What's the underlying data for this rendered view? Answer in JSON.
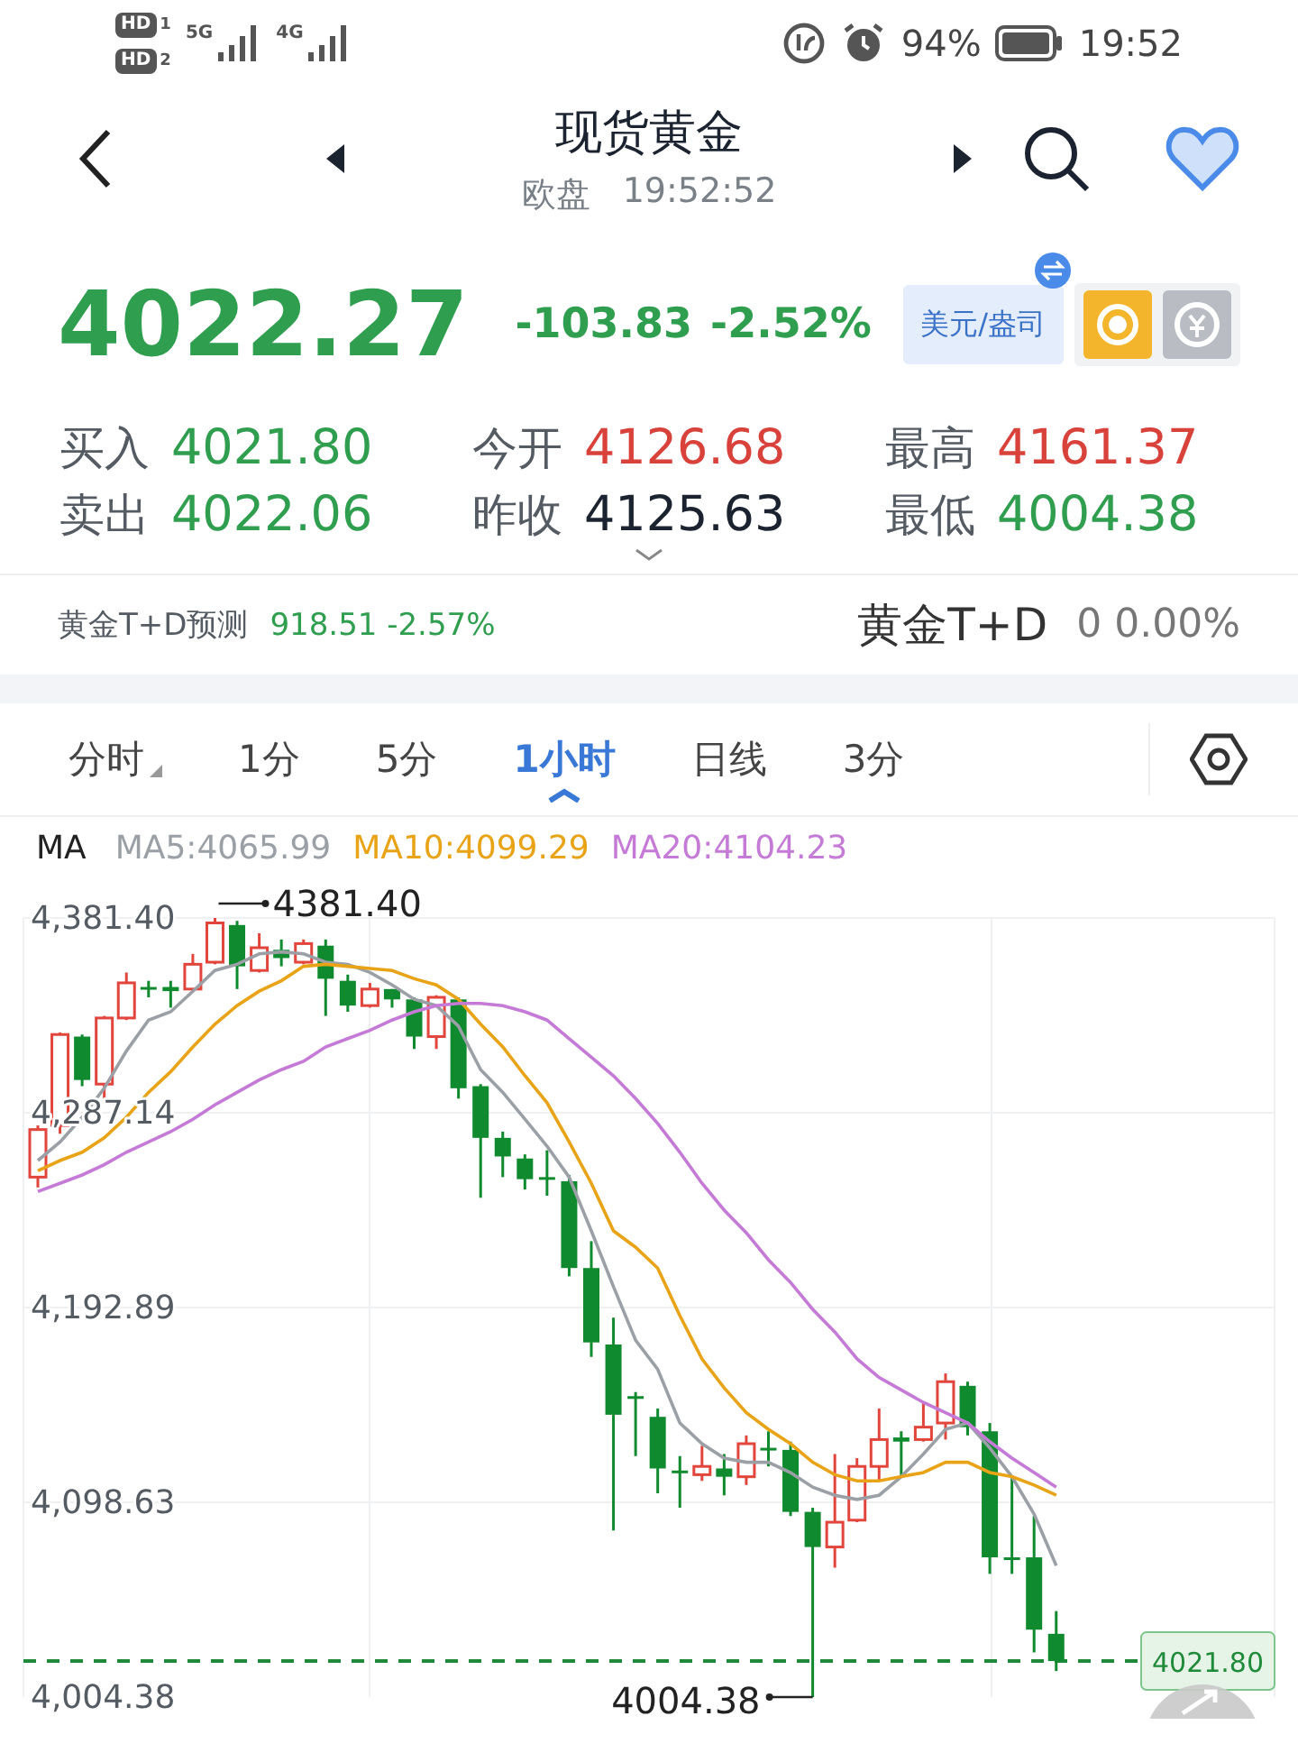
{
  "status_bar": {
    "sims": [
      {
        "label": "HD",
        "slot": "1"
      },
      {
        "label": "HD",
        "slot": "2"
      }
    ],
    "networks": [
      "5G",
      "4G"
    ],
    "battery": "94%",
    "time": "19:52"
  },
  "header": {
    "title": "现货黄金",
    "market": "欧盘",
    "time": "19:52:52",
    "favorite": true
  },
  "quote": {
    "price": "4022.27",
    "change": "-103.83",
    "change_pct": "-2.52%",
    "color": "#2f9e4f",
    "unit_button": "美元/盎司",
    "stats": [
      {
        "label": "买入",
        "value": "4021.80",
        "color": "#2f9e4f"
      },
      {
        "label": "今开",
        "value": "4126.68",
        "color": "#d9413b"
      },
      {
        "label": "最高",
        "value": "4161.37",
        "color": "#d9413b"
      },
      {
        "label": "卖出",
        "value": "4022.06",
        "color": "#2f9e4f"
      },
      {
        "label": "昨收",
        "value": "4125.63",
        "color": "#1b2330"
      },
      {
        "label": "最低",
        "value": "4004.38",
        "color": "#2f9e4f"
      }
    ]
  },
  "forecast": {
    "label": "黄金T+D预测",
    "value": "918.51 -2.57%",
    "related_name": "黄金T+D",
    "related_value": "0 0.00%"
  },
  "tabs": [
    {
      "label": "分时",
      "selected": false,
      "dropdown": true
    },
    {
      "label": "1分",
      "selected": false,
      "dropdown": false
    },
    {
      "label": "5分",
      "selected": false,
      "dropdown": false
    },
    {
      "label": "1小时",
      "selected": true,
      "dropdown": false
    },
    {
      "label": "日线",
      "selected": false,
      "dropdown": false
    },
    {
      "label": "3分",
      "selected": false,
      "dropdown": false
    }
  ],
  "legend": {
    "title": "MA"
  },
  "chart": {
    "chart_data": {
      "type": "candlestick",
      "grid": true,
      "ylim": [
        4004.38,
        4381.4
      ],
      "yticks": [
        {
          "value": 4381.4,
          "label": "4,381.40"
        },
        {
          "value": 4287.14,
          "label": "4,287.14"
        },
        {
          "value": 4192.89,
          "label": "4,192.89"
        },
        {
          "value": 4098.63,
          "label": "4,098.63"
        },
        {
          "value": 4004.38,
          "label": "4,004.38"
        }
      ],
      "ohlc": [
        [
          4256,
          4281,
          4251,
          4279
        ],
        [
          4281,
          4326,
          4277,
          4325
        ],
        [
          4324,
          4325,
          4300,
          4303
        ],
        [
          4301,
          4334,
          4294,
          4333
        ],
        [
          4333,
          4355,
          4332,
          4350
        ],
        [
          4348,
          4351,
          4343,
          4347
        ],
        [
          4348,
          4351,
          4338,
          4346
        ],
        [
          4347,
          4364,
          4346,
          4359
        ],
        [
          4360,
          4381.4,
          4359,
          4379
        ],
        [
          4378,
          4380,
          4347,
          4358
        ],
        [
          4356,
          4374,
          4355,
          4367
        ],
        [
          4366,
          4371,
          4358,
          4362
        ],
        [
          4360,
          4371,
          4359,
          4369
        ],
        [
          4368,
          4371,
          4334,
          4352
        ],
        [
          4351,
          4354,
          4336,
          4339
        ],
        [
          4339,
          4350,
          4338,
          4347
        ],
        [
          4347,
          4347,
          4338,
          4342
        ],
        [
          4342,
          4343,
          4318,
          4324
        ],
        [
          4324,
          4344,
          4318,
          4343
        ],
        [
          4342,
          4343,
          4294,
          4299
        ],
        [
          4300,
          4301,
          4246,
          4275
        ],
        [
          4275,
          4278,
          4256,
          4266
        ],
        [
          4265,
          4267,
          4250,
          4255
        ],
        [
          4256,
          4269,
          4247,
          4255
        ],
        [
          4254,
          4257,
          4208,
          4212
        ],
        [
          4212,
          4225,
          4169,
          4176
        ],
        [
          4175,
          4188,
          4085,
          4141
        ],
        [
          4150,
          4152,
          4121,
          4149
        ],
        [
          4140,
          4144,
          4103,
          4115
        ],
        [
          4114,
          4121,
          4096,
          4113
        ],
        [
          4112,
          4126,
          4109,
          4116
        ],
        [
          4115,
          4122,
          4102,
          4111
        ],
        [
          4111,
          4131,
          4107,
          4127
        ],
        [
          4125,
          4133,
          4116,
          4124
        ],
        [
          4124,
          4128,
          4092,
          4094
        ],
        [
          4094,
          4096,
          4004.38,
          4077
        ],
        [
          4077,
          4122,
          4067,
          4089
        ],
        [
          4090,
          4120,
          4089,
          4116
        ],
        [
          4116,
          4144,
          4109,
          4129
        ],
        [
          4130,
          4133,
          4111,
          4128
        ],
        [
          4129,
          4147,
          4128,
          4135
        ],
        [
          4137,
          4161,
          4129,
          4157
        ],
        [
          4155,
          4157,
          4131,
          4135
        ],
        [
          4133,
          4137,
          4064,
          4072
        ],
        [
          4072,
          4111,
          4064,
          4071
        ],
        [
          4072,
          4092,
          4026,
          4037
        ],
        [
          4035,
          4046,
          4017,
          4021.8
        ]
      ],
      "series": [
        {
          "name": "MA5:4065.99",
          "type": "line",
          "color": "#9aa0a6",
          "values": [
            4264,
            4273,
            4285,
            4299,
            4317,
            4332,
            4336,
            4346,
            4356,
            4359,
            4364,
            4365,
            4364,
            4360,
            4359,
            4355,
            4349,
            4342,
            4339,
            4329,
            4308,
            4297,
            4284,
            4271,
            4256,
            4230,
            4203,
            4177,
            4163,
            4137,
            4127,
            4120,
            4118,
            4118,
            4113,
            4106,
            4102,
            4100,
            4102,
            4111,
            4122,
            4134,
            4137,
            4125,
            4111,
            4093,
            4068
          ]
        },
        {
          "name": "MA10:4099.29",
          "type": "line",
          "color": "#e8a317",
          "values": [
            4259,
            4264,
            4268,
            4275,
            4285,
            4297,
            4307,
            4319,
            4330,
            4339,
            4346,
            4351,
            4358,
            4359,
            4358,
            4357,
            4356,
            4352,
            4349,
            4342,
            4330,
            4319,
            4305,
            4292,
            4273,
            4253,
            4230,
            4222,
            4212,
            4189,
            4168,
            4154,
            4142,
            4134,
            4127,
            4118,
            4112,
            4109,
            4109,
            4111,
            4113,
            4118,
            4118,
            4113,
            4111,
            4107,
            4102
          ]
        },
        {
          "name": "MA20:4104.23",
          "type": "line",
          "color": "#c47ad6",
          "values": [
            4249,
            4253,
            4257,
            4262,
            4268,
            4273,
            4278,
            4284,
            4291,
            4297,
            4303,
            4308,
            4312,
            4319,
            4323,
            4327,
            4332,
            4336,
            4339,
            4340,
            4340,
            4339,
            4336,
            4332,
            4323,
            4314,
            4305,
            4294,
            4282,
            4268,
            4253,
            4240,
            4229,
            4216,
            4205,
            4192,
            4181,
            4168,
            4159,
            4153,
            4147,
            4142,
            4137,
            4128,
            4120,
            4113,
            4106
          ]
        }
      ],
      "annotations": [
        "4381.40",
        "4004.38"
      ],
      "ref_lines": [
        {
          "axis": "y",
          "value": 4021.8,
          "label": "4021.80"
        }
      ]
    }
  }
}
